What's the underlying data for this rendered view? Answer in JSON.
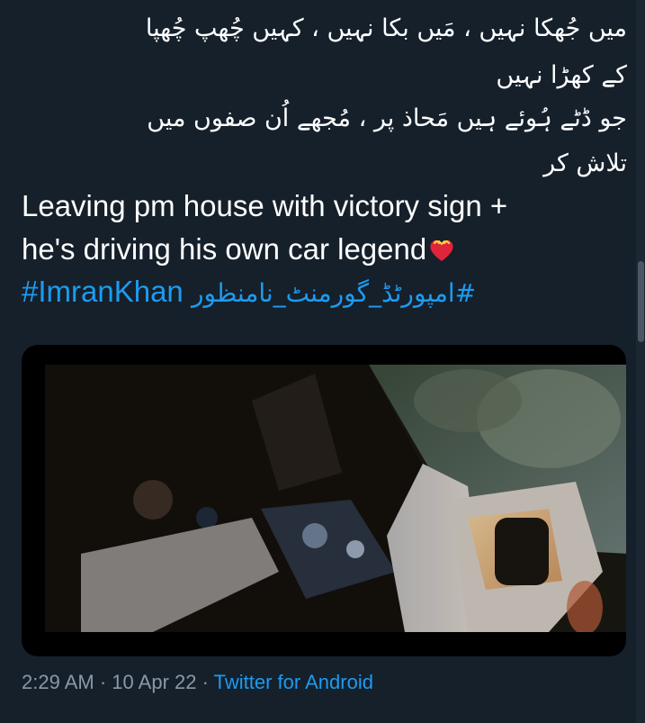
{
  "tweet": {
    "poem_lines": [
      "میں جُھکا نہیں ، مَیں بکا نہیں ، کہیں چُھپ چُھپا",
      "کے کھڑا نہیں",
      "جو ڈٹے ہُوئے ہیں مَحاذ پر ، مُجھے اُن صفوں میں",
      "تلاش کر"
    ],
    "text_line_1": "Leaving pm house with victory sign +",
    "text_line_2": "he's driving his own car legend",
    "heart_emoji": "heart-with-ribbon-icon",
    "hashtag_1": "#ImranKhan",
    "hashtag_2": "#امپورٹڈ_گورمنٹ_نامنظور",
    "time": "2:29 AM",
    "date": "10 Apr 22",
    "source": "Twitter for Android",
    "separator": "·"
  },
  "colors": {
    "background": "#15202b",
    "text": "#ffffff",
    "link": "#1d9bf0",
    "muted": "#8b98a5"
  }
}
